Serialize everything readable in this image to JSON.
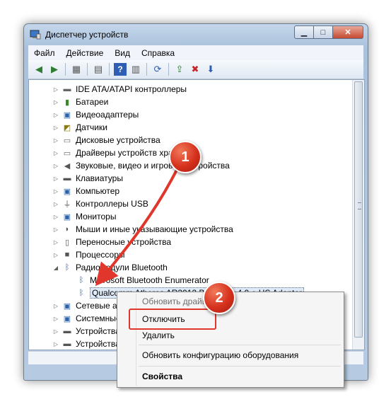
{
  "window": {
    "title": "Диспетчер устройств"
  },
  "menubar": {
    "items": [
      "Файл",
      "Действие",
      "Вид",
      "Справка"
    ]
  },
  "tree": {
    "categories": [
      "IDE ATA/ATAPI контроллеры",
      "Батареи",
      "Видеоадаптеры",
      "Датчики",
      "Дисковые устройства",
      "Драйверы устройств хранения",
      "Звуковые, видео и игровые устройства",
      "Клавиатуры",
      "Компьютер",
      "Контроллеры USB",
      "Мониторы",
      "Мыши и иные указывающие устройства",
      "Переносные устройства",
      "Процессоры",
      "Радиомодули Bluetooth"
    ],
    "bluetooth_children": [
      "Microsoft Bluetooth Enumerator",
      "Qualcomm Atheros AR3012 Bluetooth 4.0 + HS Adapter"
    ],
    "after": [
      "Сетевые адаптеры",
      "Системные устройства",
      "Устройства HID",
      "Устройства обработки изображений"
    ]
  },
  "context_menu": {
    "update": "Обновить драйверы...",
    "disable": "Отключить",
    "uninstall": "Удалить",
    "scan": "Обновить конфигурацию оборудования",
    "properties": "Свойства"
  },
  "annotations": {
    "step1": "1",
    "step2": "2"
  },
  "colors": {
    "accent": "#d6311d"
  }
}
